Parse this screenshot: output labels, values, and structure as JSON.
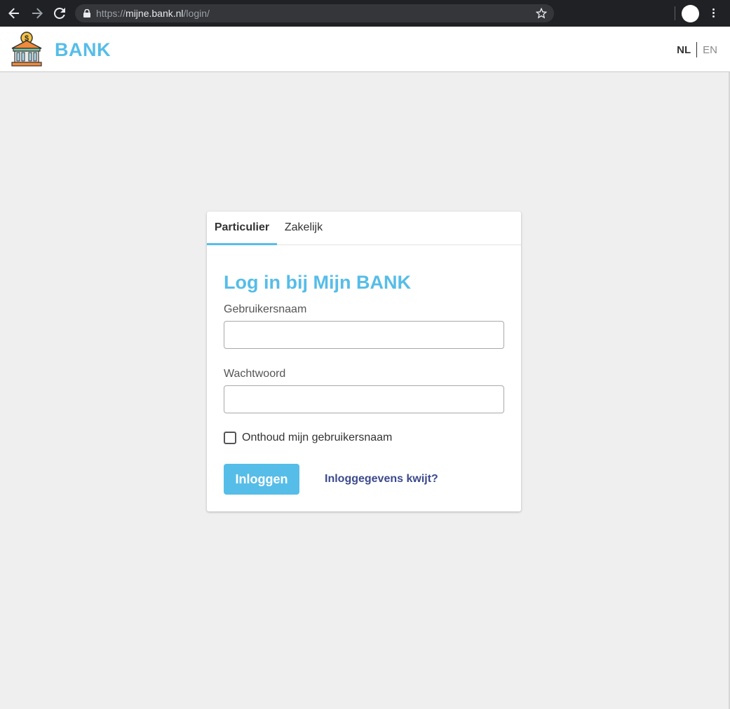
{
  "browser": {
    "url_scheme": "https://",
    "url_host": "mijne.bank.nl",
    "url_path": "/login/",
    "icons": [
      "back-arrow-icon",
      "forward-arrow-icon",
      "reload-icon",
      "lock-icon",
      "star-icon",
      "profile-icon",
      "menu-kebab-icon"
    ]
  },
  "header": {
    "brand": "BANK",
    "logo_icon": "bank-building-icon",
    "languages": [
      {
        "code": "NL",
        "active": true
      },
      {
        "code": "EN",
        "active": false
      }
    ]
  },
  "login": {
    "tabs": [
      {
        "label": "Particulier",
        "active": true
      },
      {
        "label": "Zakelijk",
        "active": false
      }
    ],
    "title": "Log in bij Mijn BANK",
    "username_label": "Gebruikersnaam",
    "username_value": "",
    "password_label": "Wachtwoord",
    "password_value": "",
    "remember_label": "Onthoud mijn gebruikersnaam",
    "remember_checked": false,
    "submit_label": "Inloggen",
    "forgot_label": "Inloggegevens kwijt?"
  },
  "colors": {
    "accent": "#56bde8",
    "link": "#3b4a8c",
    "page_bg": "#efefef"
  }
}
